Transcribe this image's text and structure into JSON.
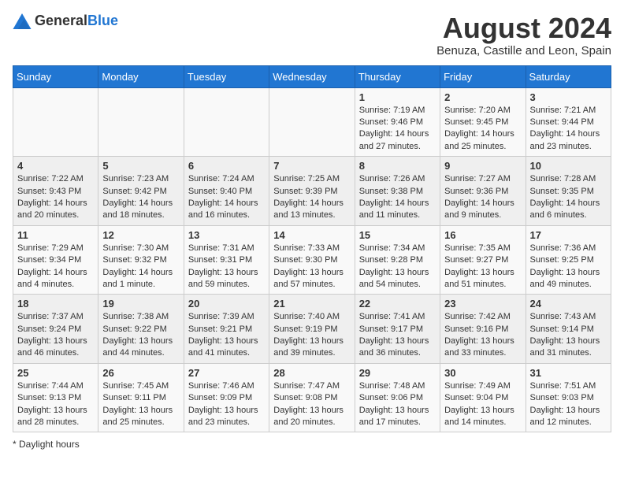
{
  "header": {
    "logo_general": "General",
    "logo_blue": "Blue",
    "month_year": "August 2024",
    "location": "Benuza, Castille and Leon, Spain"
  },
  "days_of_week": [
    "Sunday",
    "Monday",
    "Tuesday",
    "Wednesday",
    "Thursday",
    "Friday",
    "Saturday"
  ],
  "weeks": [
    [
      {
        "day": "",
        "info": ""
      },
      {
        "day": "",
        "info": ""
      },
      {
        "day": "",
        "info": ""
      },
      {
        "day": "",
        "info": ""
      },
      {
        "day": "1",
        "info": "Sunrise: 7:19 AM\nSunset: 9:46 PM\nDaylight: 14 hours and 27 minutes."
      },
      {
        "day": "2",
        "info": "Sunrise: 7:20 AM\nSunset: 9:45 PM\nDaylight: 14 hours and 25 minutes."
      },
      {
        "day": "3",
        "info": "Sunrise: 7:21 AM\nSunset: 9:44 PM\nDaylight: 14 hours and 23 minutes."
      }
    ],
    [
      {
        "day": "4",
        "info": "Sunrise: 7:22 AM\nSunset: 9:43 PM\nDaylight: 14 hours and 20 minutes."
      },
      {
        "day": "5",
        "info": "Sunrise: 7:23 AM\nSunset: 9:42 PM\nDaylight: 14 hours and 18 minutes."
      },
      {
        "day": "6",
        "info": "Sunrise: 7:24 AM\nSunset: 9:40 PM\nDaylight: 14 hours and 16 minutes."
      },
      {
        "day": "7",
        "info": "Sunrise: 7:25 AM\nSunset: 9:39 PM\nDaylight: 14 hours and 13 minutes."
      },
      {
        "day": "8",
        "info": "Sunrise: 7:26 AM\nSunset: 9:38 PM\nDaylight: 14 hours and 11 minutes."
      },
      {
        "day": "9",
        "info": "Sunrise: 7:27 AM\nSunset: 9:36 PM\nDaylight: 14 hours and 9 minutes."
      },
      {
        "day": "10",
        "info": "Sunrise: 7:28 AM\nSunset: 9:35 PM\nDaylight: 14 hours and 6 minutes."
      }
    ],
    [
      {
        "day": "11",
        "info": "Sunrise: 7:29 AM\nSunset: 9:34 PM\nDaylight: 14 hours and 4 minutes."
      },
      {
        "day": "12",
        "info": "Sunrise: 7:30 AM\nSunset: 9:32 PM\nDaylight: 14 hours and 1 minute."
      },
      {
        "day": "13",
        "info": "Sunrise: 7:31 AM\nSunset: 9:31 PM\nDaylight: 13 hours and 59 minutes."
      },
      {
        "day": "14",
        "info": "Sunrise: 7:33 AM\nSunset: 9:30 PM\nDaylight: 13 hours and 57 minutes."
      },
      {
        "day": "15",
        "info": "Sunrise: 7:34 AM\nSunset: 9:28 PM\nDaylight: 13 hours and 54 minutes."
      },
      {
        "day": "16",
        "info": "Sunrise: 7:35 AM\nSunset: 9:27 PM\nDaylight: 13 hours and 51 minutes."
      },
      {
        "day": "17",
        "info": "Sunrise: 7:36 AM\nSunset: 9:25 PM\nDaylight: 13 hours and 49 minutes."
      }
    ],
    [
      {
        "day": "18",
        "info": "Sunrise: 7:37 AM\nSunset: 9:24 PM\nDaylight: 13 hours and 46 minutes."
      },
      {
        "day": "19",
        "info": "Sunrise: 7:38 AM\nSunset: 9:22 PM\nDaylight: 13 hours and 44 minutes."
      },
      {
        "day": "20",
        "info": "Sunrise: 7:39 AM\nSunset: 9:21 PM\nDaylight: 13 hours and 41 minutes."
      },
      {
        "day": "21",
        "info": "Sunrise: 7:40 AM\nSunset: 9:19 PM\nDaylight: 13 hours and 39 minutes."
      },
      {
        "day": "22",
        "info": "Sunrise: 7:41 AM\nSunset: 9:17 PM\nDaylight: 13 hours and 36 minutes."
      },
      {
        "day": "23",
        "info": "Sunrise: 7:42 AM\nSunset: 9:16 PM\nDaylight: 13 hours and 33 minutes."
      },
      {
        "day": "24",
        "info": "Sunrise: 7:43 AM\nSunset: 9:14 PM\nDaylight: 13 hours and 31 minutes."
      }
    ],
    [
      {
        "day": "25",
        "info": "Sunrise: 7:44 AM\nSunset: 9:13 PM\nDaylight: 13 hours and 28 minutes."
      },
      {
        "day": "26",
        "info": "Sunrise: 7:45 AM\nSunset: 9:11 PM\nDaylight: 13 hours and 25 minutes."
      },
      {
        "day": "27",
        "info": "Sunrise: 7:46 AM\nSunset: 9:09 PM\nDaylight: 13 hours and 23 minutes."
      },
      {
        "day": "28",
        "info": "Sunrise: 7:47 AM\nSunset: 9:08 PM\nDaylight: 13 hours and 20 minutes."
      },
      {
        "day": "29",
        "info": "Sunrise: 7:48 AM\nSunset: 9:06 PM\nDaylight: 13 hours and 17 minutes."
      },
      {
        "day": "30",
        "info": "Sunrise: 7:49 AM\nSunset: 9:04 PM\nDaylight: 13 hours and 14 minutes."
      },
      {
        "day": "31",
        "info": "Sunrise: 7:51 AM\nSunset: 9:03 PM\nDaylight: 13 hours and 12 minutes."
      }
    ]
  ],
  "footer": {
    "note": "Daylight hours"
  }
}
